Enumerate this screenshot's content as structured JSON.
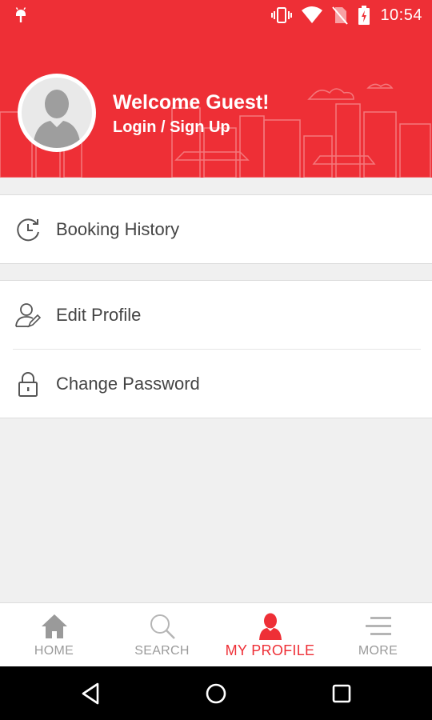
{
  "status_bar": {
    "time": "10:54",
    "icons": [
      "android-icon",
      "vibrate-icon",
      "wifi-icon",
      "no-sim-icon",
      "battery-charging-icon"
    ]
  },
  "header": {
    "welcome_text": "Welcome Guest!",
    "login_text": "Login / Sign Up",
    "avatar": "default-avatar-icon",
    "background_color": "#ee2f36"
  },
  "menu": {
    "group1": [
      {
        "label": "Booking History",
        "icon": "history-clock-icon"
      }
    ],
    "group2": [
      {
        "label": "Edit Profile",
        "icon": "edit-profile-icon"
      },
      {
        "label": "Change Password",
        "icon": "lock-icon"
      }
    ]
  },
  "bottom_nav": {
    "tabs": [
      {
        "label": "HOME",
        "icon": "home-icon",
        "active": false
      },
      {
        "label": "SEARCH",
        "icon": "search-icon",
        "active": false
      },
      {
        "label": "MY PROFILE",
        "icon": "person-icon",
        "active": true
      },
      {
        "label": "MORE",
        "icon": "menu-lines-icon",
        "active": false
      }
    ],
    "active_color": "#ee2f36",
    "inactive_color": "#9a9a9a"
  },
  "system_nav": {
    "buttons": [
      "back-icon",
      "home-circle-icon",
      "recents-icon"
    ]
  }
}
